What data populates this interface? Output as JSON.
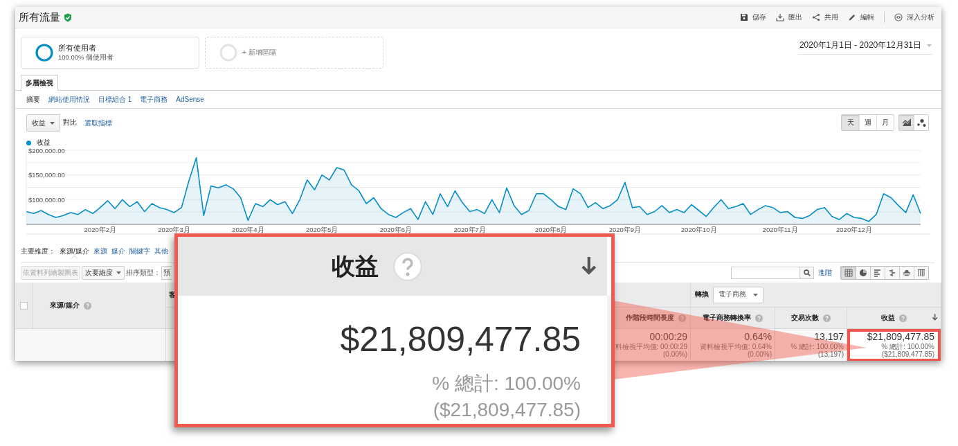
{
  "header": {
    "title": "所有流量",
    "verified": true,
    "actions": [
      {
        "kind": "save",
        "label": "儲存"
      },
      {
        "kind": "export",
        "label": "匯出"
      },
      {
        "kind": "share",
        "label": "共用"
      },
      {
        "kind": "edit",
        "label": "編輯"
      },
      {
        "kind": "insights",
        "label": "深入分析"
      }
    ]
  },
  "segments": [
    {
      "kind": "active",
      "name": "所有使用者",
      "detail": "100.00% 個使用者"
    },
    {
      "kind": "add",
      "name": "+ 新增區隔"
    }
  ],
  "date_range": "2020年1月1日 - 2020年12月31日",
  "nav": {
    "tabs": [
      {
        "label": "多層檢視",
        "selected": true
      }
    ],
    "links": [
      {
        "label": "摘要",
        "selected": true
      },
      {
        "label": "網站使用情況",
        "selected": false
      },
      {
        "label": "目標組合 1",
        "selected": false
      },
      {
        "label": "電子商務",
        "selected": false
      },
      {
        "label": "AdSense",
        "selected": false
      }
    ]
  },
  "chart_controls": {
    "metric": "收益",
    "compare_label": "對比",
    "pick_metric": "選取指標",
    "periods": [
      {
        "label": "天",
        "selected": true
      },
      {
        "label": "週",
        "selected": false
      },
      {
        "label": "月",
        "selected": false
      }
    ],
    "chart_types": [
      {
        "kind": "line",
        "selected": true
      },
      {
        "kind": "motion",
        "selected": false
      }
    ]
  },
  "chart": {
    "chart_data": {
      "type": "area",
      "ylim": [
        50000,
        200000
      ],
      "yticks": [
        {
          "value": 200000,
          "label": "$200,000.00"
        },
        {
          "value": 150000,
          "label": "$150,000.00"
        },
        {
          "value": 100000,
          "label": "$100,000.00"
        }
      ],
      "categories": [
        null,
        null,
        null,
        null,
        null,
        null,
        null,
        null,
        null,
        null,
        "2020年2月",
        null,
        null,
        null,
        null,
        null,
        null,
        null,
        null,
        null,
        "2020年3月",
        null,
        null,
        null,
        null,
        null,
        null,
        null,
        null,
        null,
        "2020年4月",
        null,
        null,
        null,
        null,
        null,
        null,
        null,
        null,
        null,
        "2020年5月",
        null,
        null,
        null,
        null,
        null,
        null,
        null,
        null,
        null,
        "2020年6月",
        null,
        null,
        null,
        null,
        null,
        null,
        null,
        null,
        null,
        "2020年7月",
        null,
        null,
        null,
        null,
        null,
        null,
        null,
        null,
        null,
        null,
        "2020年8月",
        null,
        null,
        null,
        null,
        null,
        null,
        null,
        null,
        null,
        "2020年9月",
        null,
        null,
        null,
        null,
        null,
        null,
        null,
        null,
        null,
        "2020年10月",
        null,
        null,
        null,
        null,
        null,
        null,
        null,
        null,
        null,
        null,
        "2020年11月",
        null,
        null,
        null,
        null,
        null,
        null,
        null,
        null,
        null,
        "2020年12月",
        null,
        null,
        null,
        null,
        null,
        null,
        null,
        null,
        null
      ],
      "series": [
        {
          "name": "收益",
          "color": "#058dc7",
          "values": [
            76000,
            72000,
            78000,
            70000,
            64000,
            68000,
            74000,
            70000,
            80000,
            72000,
            84000,
            98000,
            82000,
            100000,
            86000,
            96000,
            76000,
            92000,
            84000,
            80000,
            74000,
            84000,
            138000,
            185000,
            68000,
            128000,
            124000,
            130000,
            122000,
            104000,
            58000,
            92000,
            86000,
            100000,
            90000,
            96000,
            72000,
            100000,
            140000,
            120000,
            150000,
            140000,
            165000,
            160000,
            130000,
            118000,
            92000,
            104000,
            82000,
            70000,
            64000,
            74000,
            82000,
            60000,
            96000,
            70000,
            112000,
            86000,
            118000,
            94000,
            76000,
            80000,
            72000,
            100000,
            74000,
            124000,
            88000,
            70000,
            78000,
            112000,
            112000,
            100000,
            86000,
            80000,
            122000,
            112000,
            84000,
            94000,
            82000,
            88000,
            100000,
            135000,
            84000,
            86000,
            70000,
            76000,
            88000,
            74000,
            80000,
            74000,
            90000,
            78000,
            66000,
            84000,
            100000,
            82000,
            86000,
            92000,
            70000,
            80000,
            88000,
            84000,
            74000,
            76000,
            64000,
            62000,
            68000,
            80000,
            84000,
            66000,
            60000,
            72000,
            64000,
            62000,
            56000,
            70000,
            112000,
            104000,
            88000,
            74000,
            110000,
            72000
          ]
        }
      ]
    }
  },
  "dimensions": {
    "label": "主要維度：",
    "items": [
      {
        "label": "來源/媒介",
        "selected": true
      },
      {
        "label": "來源",
        "selected": false
      },
      {
        "label": "媒介",
        "selected": false
      },
      {
        "label": "關鍵字",
        "selected": false
      },
      {
        "label": "其他",
        "selected": false
      }
    ]
  },
  "toolbar": {
    "plot_rows": {
      "label": "依資料列繪製圖表",
      "disabled": true
    },
    "secondary": "次要維度",
    "sort_label": "排序類型：",
    "sort_value": "預",
    "advanced": "進階",
    "views": [
      {
        "kind": "table",
        "selected": true
      },
      {
        "kind": "pie",
        "selected": false
      },
      {
        "kind": "bars",
        "selected": false
      },
      {
        "kind": "compare",
        "selected": false
      },
      {
        "kind": "terms",
        "selected": false
      },
      {
        "kind": "pivot",
        "selected": false
      }
    ]
  },
  "table": {
    "select_all": {
      "checked": false
    },
    "conversion_label": "轉換",
    "conversion_value": "電子商務",
    "columns": [
      {
        "label": "來源/媒介",
        "help": true,
        "sorted": false
      },
      {
        "label": "客",
        "help": false,
        "sorted": false
      },
      {
        "label": "作階段時間長度",
        "help": true,
        "sorted": false
      },
      {
        "label": "電子商務轉換率",
        "help": true,
        "sorted": false
      },
      {
        "label": "交易次數",
        "help": true,
        "sorted": false
      },
      {
        "label": "收益",
        "help": true,
        "sorted": true
      }
    ],
    "rows": [
      {
        "cells": [
          {
            "highlighted": false
          },
          {
            "highlighted": false
          },
          {
            "value": "00:00:29",
            "note": "料檢視平均值: 00:00:29",
            "total": "(0.00%)",
            "highlighted": false
          },
          {
            "value": "0.64%",
            "note": "資料檢視平均值: 0.64%",
            "total": "(0.00%)",
            "highlighted": false
          },
          {
            "value": "13,197",
            "note": "% 總計: 100.00%",
            "total": "(13,197)",
            "highlighted": false
          },
          {
            "value": "$21,809,477.85",
            "note": "% 總計: 100.00%",
            "total": "($21,809,477.85)",
            "highlighted": true
          }
        ]
      }
    ]
  },
  "magnifier": {
    "title": "收益",
    "help": true,
    "sorted": true,
    "value": "$21,809,477.85",
    "share": "% 總計: 100.00%",
    "total": "($21,809,477.85)"
  }
}
